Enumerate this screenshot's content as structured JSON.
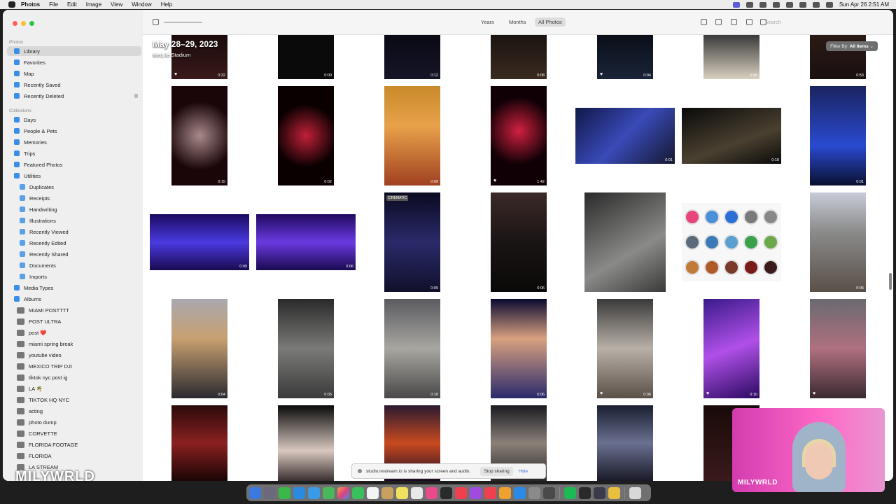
{
  "menubar": {
    "app": "Photos",
    "items": [
      "File",
      "Edit",
      "Image",
      "View",
      "Window",
      "Help"
    ],
    "clock": "Sun Apr 26  2:51 AM"
  },
  "sidebar": {
    "section_photos": "Photos",
    "library": "Library",
    "favorites": "Favorites",
    "map": "Map",
    "recently_saved": "Recently Saved",
    "recently_deleted": "Recently Deleted",
    "section_collections": "Collections",
    "days": "Days",
    "people_pets": "People & Pets",
    "memories": "Memories",
    "trips": "Trips",
    "featured_photos": "Featured Photos",
    "utilities": "Utilities",
    "utility_items": [
      "Duplicates",
      "Receipts",
      "Handwriting",
      "Illustrations",
      "Recently Viewed",
      "Recently Edited",
      "Recently Shared",
      "Documents",
      "Imports"
    ],
    "media_types": "Media Types",
    "albums": "Albums",
    "album_items": [
      "MIAMI POSTTTT",
      "POST ULTRA",
      "post ❤️",
      "miami spring break",
      "youtube video",
      "MEXICO TRIP DJI",
      "tiktok nyc post ig",
      "LA 🌴",
      "TIKTOK HQ NYC",
      "acting",
      "photo dump",
      "CORVETTE",
      "FLORIDA FOOTAGE",
      "FLORIDA",
      "LA STREAM"
    ]
  },
  "toolbar": {
    "years": "Years",
    "months": "Months",
    "all_photos": "All Photos",
    "search_placeholder": "Search"
  },
  "grid": {
    "date_title": "May 28–29, 2023",
    "location": "MetLife Stadium",
    "filter_label": "Filter By:",
    "filter_value": "All Items",
    "cinematic_badge": "CINEMATIC",
    "durations": [
      "0:32",
      "0:00",
      "0:12",
      "0:08",
      "0:04",
      "0:06",
      "0:53",
      "0:15",
      "0:02",
      "0:09",
      "1:42",
      "0:01",
      "0:18",
      "0:01",
      "0:09",
      "0:06",
      "0:09",
      "0:06",
      "0:05",
      "0:04",
      "0:05",
      "0:10",
      "0:06",
      "0:06",
      "0:10"
    ],
    "swatch_colors": [
      "#e8457a",
      "#4a90d8",
      "#2a6ed6",
      "#7a7a7a",
      "#888888",
      "#5a6a7a",
      "#3a7ab8",
      "#5a9fd0",
      "#3aa04a",
      "#6aa84a",
      "#c07a3a",
      "#b05a2a",
      "#7a3a2a",
      "#7a1a1a",
      "#3a1a1a"
    ]
  },
  "share_bar": {
    "message": "studio.restream.io is sharing your screen and audio.",
    "stop": "Stop sharing",
    "hide": "Hide"
  },
  "watermark": "MILYWRLD",
  "camera_label": "MILYWRLD"
}
